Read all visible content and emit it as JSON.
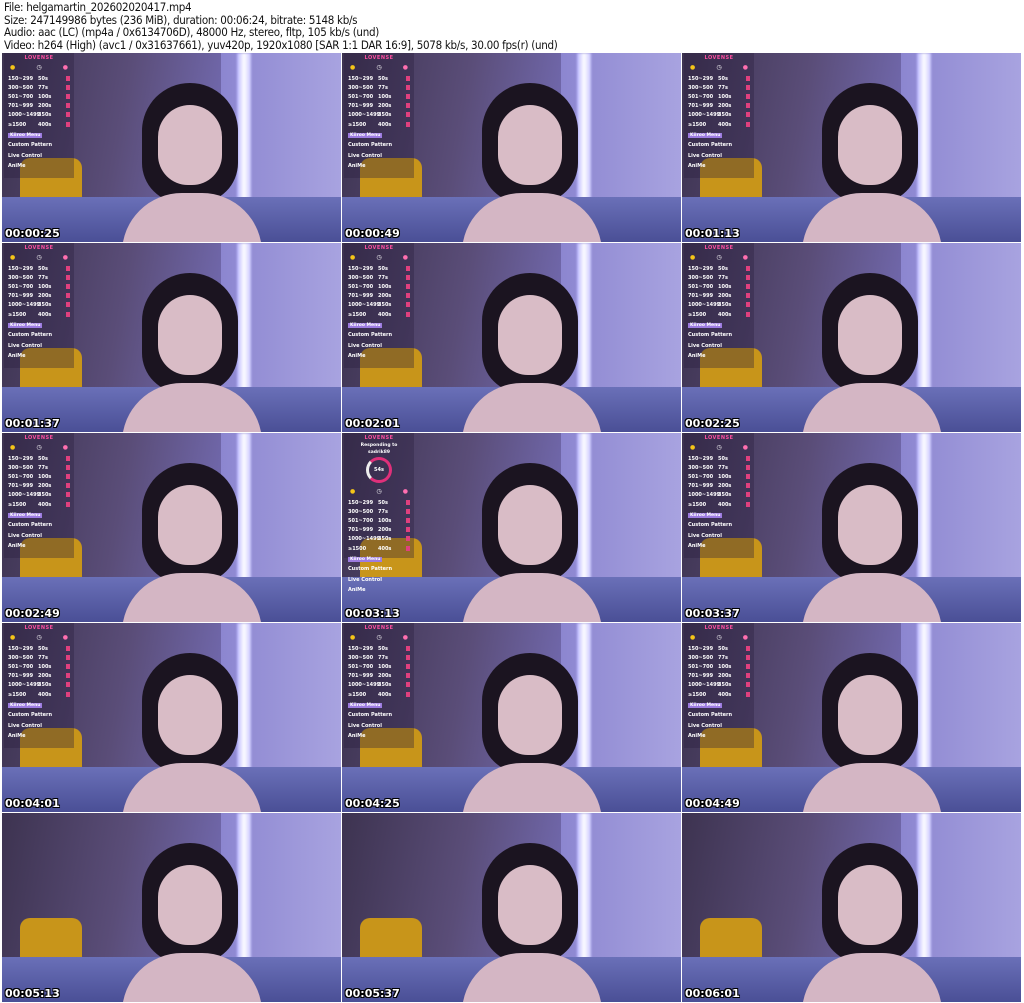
{
  "header": {
    "file": "File: helgamartin_202602020417.mp4",
    "size": "Size: 247149986 bytes (236 MiB), duration: 00:06:24, bitrate: 5148 kb/s",
    "audio": "Audio: aac (LC) (mp4a / 0x6134706D), 48000 Hz, stereo, fltp, 105 kb/s (und)",
    "video": "Video: h264 (High) (avc1 / 0x31637661), yuv420p, 1920x1080 [SAR 1:1 DAR 16:9], 5078 kb/s, 30.00 fps(r) (und)"
  },
  "overlay": {
    "brand": "LOVENSE",
    "responding_label": "Responding to",
    "responding_user": "sadrik89",
    "dial_value": "54s",
    "tiers": [
      {
        "range": "150~299",
        "duration": "50s"
      },
      {
        "range": "300~500",
        "duration": "77s"
      },
      {
        "range": "501~700",
        "duration": "100s"
      },
      {
        "range": "701~999",
        "duration": "200s"
      },
      {
        "range": "1000~1499",
        "duration": "350s"
      },
      {
        "range": "≥1500",
        "duration": "400s"
      }
    ],
    "tag": "Kiiroo Menu",
    "options": [
      "Custom Pattern",
      "Live Control",
      "AniMe"
    ]
  },
  "thumbnails": [
    {
      "time": "00:00:25",
      "overlay": true
    },
    {
      "time": "00:00:49",
      "overlay": true
    },
    {
      "time": "00:01:13",
      "overlay": true
    },
    {
      "time": "00:01:37",
      "overlay": true
    },
    {
      "time": "00:02:01",
      "overlay": true
    },
    {
      "time": "00:02:25",
      "overlay": true
    },
    {
      "time": "00:02:49",
      "overlay": true
    },
    {
      "time": "00:03:13",
      "overlay": true,
      "responding": true
    },
    {
      "time": "00:03:37",
      "overlay": true
    },
    {
      "time": "00:04:01",
      "overlay": true
    },
    {
      "time": "00:04:25",
      "overlay": true
    },
    {
      "time": "00:04:49",
      "overlay": true
    },
    {
      "time": "00:05:13",
      "overlay": false
    },
    {
      "time": "00:05:37",
      "overlay": false
    },
    {
      "time": "00:06:01",
      "overlay": false
    }
  ]
}
